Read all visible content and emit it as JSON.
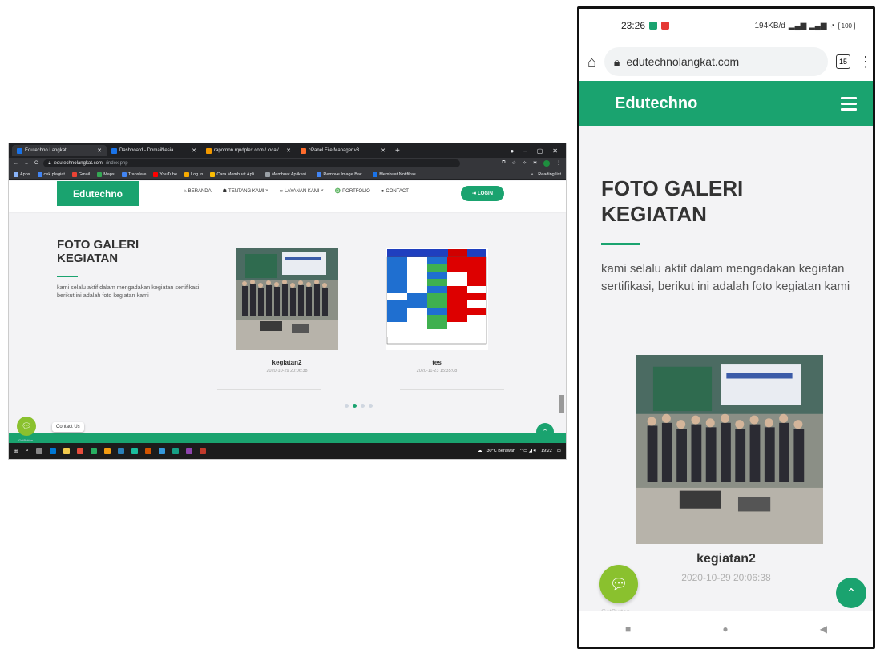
{
  "desktop": {
    "tabs": [
      {
        "title": "Edutechno Langkat",
        "active": true
      },
      {
        "title": "Dashboard - DomaiNesia",
        "active": false
      },
      {
        "title": "rapornon.rqndplex.com / local/...",
        "active": false
      },
      {
        "title": "cPanel File Manager v3",
        "active": false
      }
    ],
    "new_tab": "+",
    "address": {
      "host": "edutechnolangkat.com",
      "path": "/index.php"
    },
    "bookmarks": [
      "Apps",
      "cek plagiat",
      "Gmail",
      "Maps",
      "Translate",
      "YouTube",
      "Log In",
      "Cara Membuat Apli...",
      "Membuat Aplikasi...",
      "Remove Image Bac...",
      "Membuat Notifikas..."
    ],
    "bookmarks_right": [
      "»",
      "Reading list"
    ],
    "site": {
      "logo": "Edutechno",
      "menu": [
        {
          "icon": "home-icon",
          "label": "BERANDA"
        },
        {
          "icon": "users-icon",
          "label": "TENTANG KAMI ˅"
        },
        {
          "icon": "handshake-icon",
          "label": "LAYANAN KAMI ˅"
        },
        {
          "icon": "ribbon-icon",
          "label": "PORTFOLIO"
        },
        {
          "icon": "chat-icon",
          "label": "CONTACT"
        }
      ],
      "login": "LOGIN",
      "heading": "FOTO GALERI KEGIATAN",
      "description": "kami selalu aktif dalam mengadakan kegiatan sertifikasi, berikut ini adalah foto kegiatan kami",
      "cards": [
        {
          "caption": "kegiatan2",
          "date": "2020-10-29 20:06:38"
        },
        {
          "caption": "tes",
          "date": "2020-11-23 15:35:08"
        }
      ],
      "contact_bubble": "Contact Us",
      "getbutton": "GetButton"
    },
    "taskbar": {
      "weather": "30°C Berawan",
      "time": "19:22"
    }
  },
  "phone": {
    "status": {
      "time": "23:26",
      "network": "194KB/d"
    },
    "battery": "100",
    "url": "edutechnolangkat.com",
    "tabs_count": "15",
    "brand": "Edutechno",
    "heading": "FOTO GALERI KEGIATAN",
    "description": "kami selalu aktif dalam mengadakan kegiatan sertifikasi, berikut ini adalah foto kegiatan kami",
    "card": {
      "caption": "kegiatan2",
      "date": "2020-10-29 20:06:38"
    },
    "getbutton": "GetButton"
  },
  "colors": {
    "brand_green": "#1aa36f",
    "chat_green": "#8ac12e"
  }
}
